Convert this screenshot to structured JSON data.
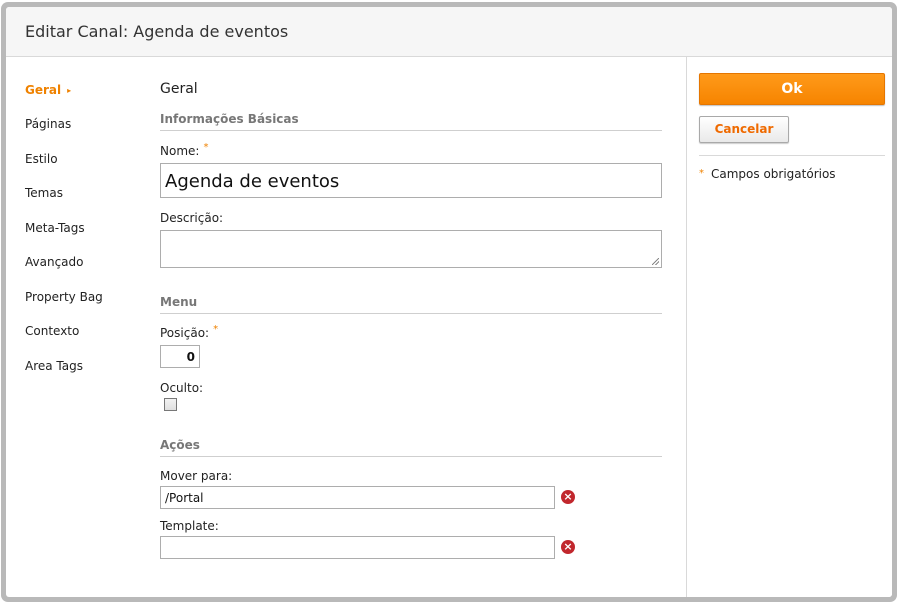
{
  "dialog": {
    "title": "Editar Canal: Agenda de eventos"
  },
  "nav": {
    "items": [
      {
        "label": "Geral",
        "active": true
      },
      {
        "label": "Páginas"
      },
      {
        "label": "Estilo"
      },
      {
        "label": "Temas"
      },
      {
        "label": "Meta-Tags"
      },
      {
        "label": "Avançado"
      },
      {
        "label": "Property Bag"
      },
      {
        "label": "Contexto"
      },
      {
        "label": "Area Tags"
      }
    ],
    "active_arrow": "▸"
  },
  "form": {
    "section_title": "Geral",
    "basic": {
      "heading": "Informações Básicas",
      "name_label": "Nome:",
      "name_value": "Agenda de eventos",
      "description_label": "Descrição:",
      "description_value": ""
    },
    "menu": {
      "heading": "Menu",
      "position_label": "Posição:",
      "position_value": "0",
      "hidden_label": "Oculto:",
      "hidden_checked": false
    },
    "actions": {
      "heading": "Ações",
      "move_label": "Mover para:",
      "move_value": "/Portal",
      "template_label": "Template:",
      "template_value": ""
    },
    "required_marker": "*"
  },
  "sidebar": {
    "ok_label": "Ok",
    "cancel_label": "Cancelar",
    "required_note": "Campos obrigatórios"
  },
  "colors": {
    "accent": "#f68400",
    "clear_icon": "#c1272d",
    "frame": "#b9b9b9"
  },
  "icons": {
    "clear": "x-circle-icon",
    "required": "asterisk-icon"
  }
}
